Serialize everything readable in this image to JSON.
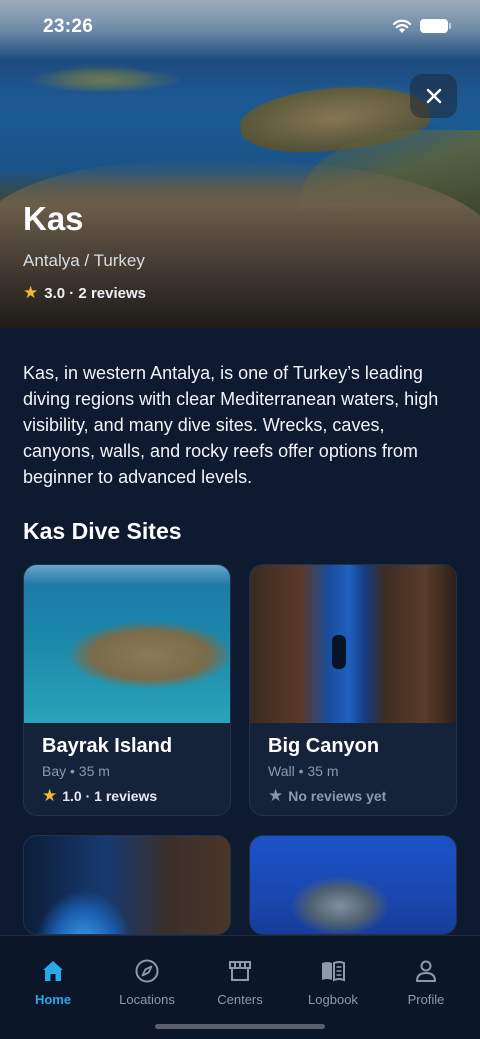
{
  "status_bar": {
    "time": "23:26"
  },
  "hero": {
    "title": "Kas",
    "subtitle": "Antalya / Turkey",
    "rating": "3.0 · 2 reviews"
  },
  "description": "Kas, in western Antalya, is one of Turkey’s leading diving regions with clear Mediterranean waters, high visibility, and many dive sites. Wrecks, caves, canyons, walls, and rocky reefs offer options from beginner to advanced levels.",
  "section": {
    "title": "Kas Dive Sites"
  },
  "dive_sites": [
    {
      "name": "Bayrak Island",
      "meta": "Bay • 35 m",
      "rating": "1.0 · 1 reviews"
    },
    {
      "name": "Big Canyon",
      "meta": "Wall • 35 m",
      "rating": "No reviews yet"
    }
  ],
  "tabs": [
    {
      "label": "Home",
      "icon": "home-icon",
      "active": true
    },
    {
      "label": "Locations",
      "icon": "compass-icon"
    },
    {
      "label": "Centers",
      "icon": "storefront-icon"
    },
    {
      "label": "Logbook",
      "icon": "book-icon"
    },
    {
      "label": "Profile",
      "icon": "person-icon"
    }
  ],
  "colors": {
    "accent": "#2aa8e8",
    "star": "#f5b82e",
    "background": "#0d1a30"
  }
}
